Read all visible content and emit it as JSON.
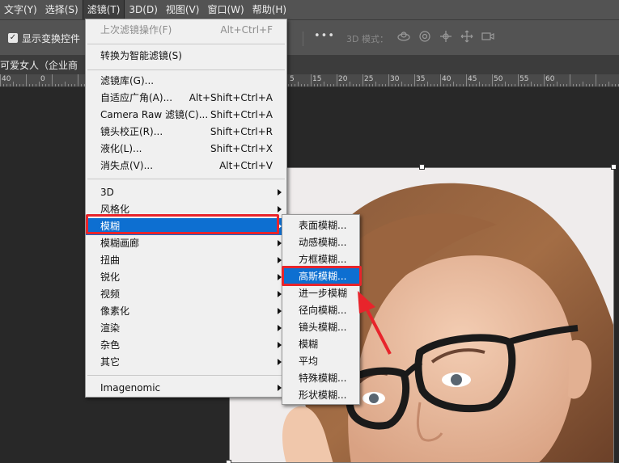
{
  "menubar": {
    "items": [
      {
        "label": "文字(Y)"
      },
      {
        "label": "选择(S)"
      },
      {
        "label": "滤镜(T)"
      },
      {
        "label": "3D(D)"
      },
      {
        "label": "视图(V)"
      },
      {
        "label": "窗口(W)"
      },
      {
        "label": "帮助(H)"
      }
    ]
  },
  "options_bar": {
    "show_transform_label": "显示变换控件",
    "show_transform_checked": true,
    "more_label": "•••",
    "mode_3d_label": "3D 模式："
  },
  "document_tab": {
    "title": "可爱女人（企业商"
  },
  "ruler": {
    "labels": [
      "40",
      "0",
      "5",
      "0",
      "10",
      "15",
      "20",
      "25",
      "30",
      "35",
      "40",
      "45",
      "50",
      "55",
      "60"
    ]
  },
  "filter_menu": {
    "items": [
      {
        "label": "上次滤镜操作(F)",
        "shortcut": "Alt+Ctrl+F",
        "disabled": true
      },
      {
        "label": "转换为智能滤镜(S)"
      },
      {
        "label": "滤镜库(G)..."
      },
      {
        "label": "自适应广角(A)...",
        "shortcut": "Alt+Shift+Ctrl+A"
      },
      {
        "label": "Camera Raw 滤镜(C)...",
        "shortcut": "Shift+Ctrl+A"
      },
      {
        "label": "镜头校正(R)...",
        "shortcut": "Shift+Ctrl+R"
      },
      {
        "label": "液化(L)...",
        "shortcut": "Shift+Ctrl+X"
      },
      {
        "label": "消失点(V)...",
        "shortcut": "Alt+Ctrl+V"
      },
      {
        "label": "3D"
      },
      {
        "label": "风格化"
      },
      {
        "label": "模糊"
      },
      {
        "label": "模糊画廊"
      },
      {
        "label": "扭曲"
      },
      {
        "label": "锐化"
      },
      {
        "label": "视频"
      },
      {
        "label": "像素化"
      },
      {
        "label": "渲染"
      },
      {
        "label": "杂色"
      },
      {
        "label": "其它"
      },
      {
        "label": "Imagenomic"
      }
    ]
  },
  "blur_submenu": {
    "items": [
      {
        "label": "表面模糊..."
      },
      {
        "label": "动感模糊..."
      },
      {
        "label": "方框模糊..."
      },
      {
        "label": "高斯模糊..."
      },
      {
        "label": "进一步模糊"
      },
      {
        "label": "径向模糊..."
      },
      {
        "label": "镜头模糊..."
      },
      {
        "label": "模糊"
      },
      {
        "label": "平均"
      },
      {
        "label": "特殊模糊..."
      },
      {
        "label": "形状模糊..."
      }
    ]
  },
  "colors": {
    "highlight": "#0d6fd1",
    "annotation_red": "#e8242b"
  }
}
